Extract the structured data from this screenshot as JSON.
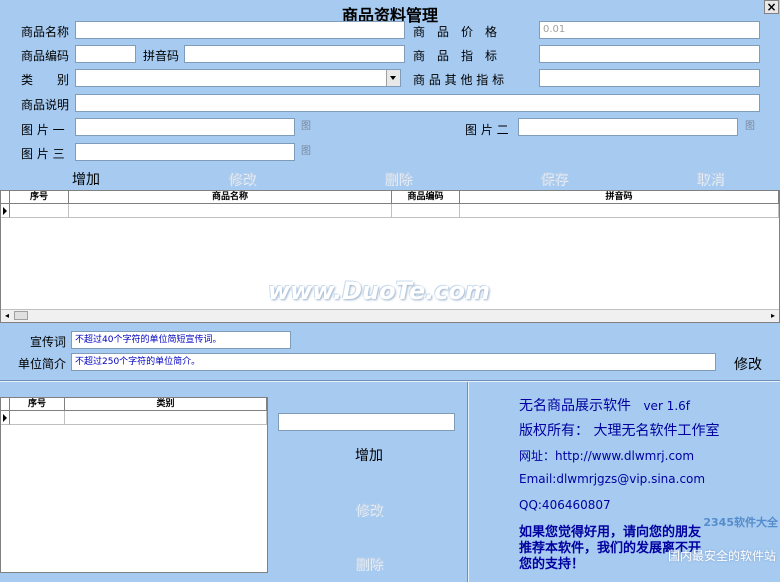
{
  "window": {
    "title": "商品资料管理",
    "close_glyph": "×"
  },
  "form": {
    "name_label": "商品名称",
    "price_label": "商　品　价　格",
    "price_value": "0.01",
    "code_label": "商品编码",
    "pinyin_label": "拼音码",
    "spec_label": "商　品　指　标",
    "category_label": "类　　别",
    "other_spec_label": "商 品 其 他 指 标",
    "desc_label": "商品说明",
    "pic1_label": "图 片 一",
    "pic2_label": "图 片 二",
    "pic3_label": "图 片 三",
    "pic_glyph": "图"
  },
  "actions": {
    "add": "增加",
    "edit": "修改",
    "delete": "删除",
    "save": "保存",
    "cancel": "取消"
  },
  "main_table": {
    "columns": [
      "序号",
      "商品名称",
      "商品编码",
      "拼音码"
    ]
  },
  "watermark": "www.DuoTe.com",
  "company": {
    "slogan_label": "宣传词",
    "slogan_placeholder": "不超过40个字符的单位简短宣传词。",
    "intro_label": "单位简介",
    "intro_placeholder": "不超过250个字符的单位简介。",
    "edit": "修改"
  },
  "category_table": {
    "columns": [
      "序号",
      "类别"
    ]
  },
  "category_actions": {
    "add": "增加",
    "edit": "修改",
    "delete": "删除"
  },
  "about": {
    "product": "无名商品展示软件",
    "version": "ver 1.6f",
    "copyright": "版权所有：  大理无名软件工作室",
    "url": "网址：http://www.dlwmrj.com",
    "email": "Email:dlwmrjgzs@vip.sina.com",
    "qq": "QQ:406460807",
    "appeal_1": "如果您觉得好用，请向您的朋友",
    "appeal_2": "推荐本软件，我们的发展离不开",
    "appeal_3": "您的支持！"
  },
  "corner_watermark": {
    "line1": "2345软件大全",
    "line2": "国内最安全的软件站"
  }
}
